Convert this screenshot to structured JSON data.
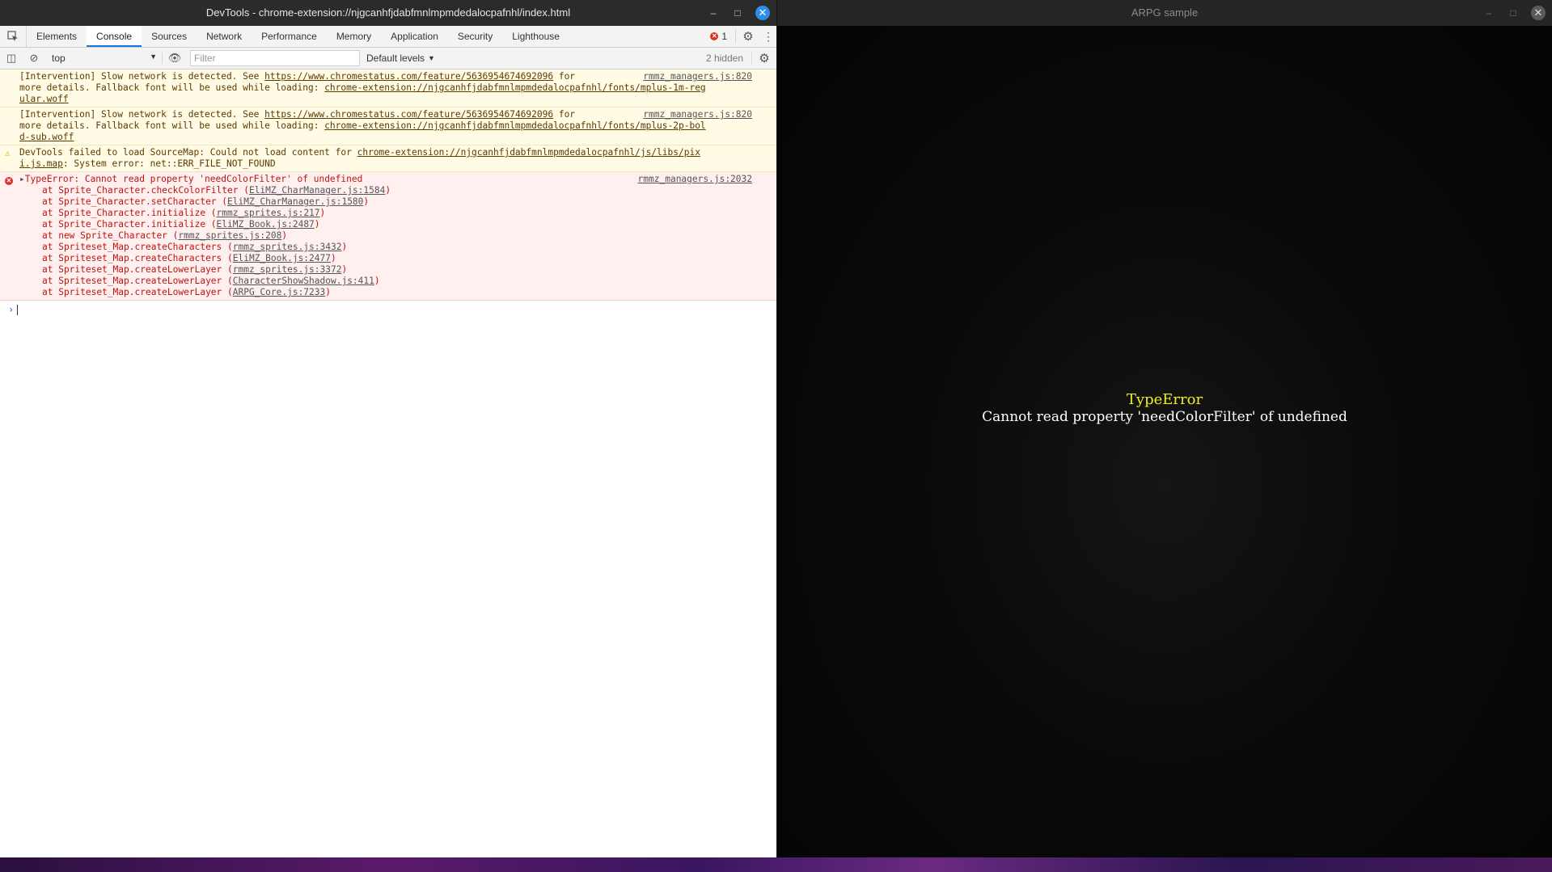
{
  "devtools": {
    "title": "DevTools - chrome-extension://njgcanhfjdabfmnlmpmdedalocpafnhl/index.html",
    "tabs": [
      "Elements",
      "Console",
      "Sources",
      "Network",
      "Performance",
      "Memory",
      "Application",
      "Security",
      "Lighthouse"
    ],
    "active_tab": "Console",
    "error_count": "1",
    "toolbar": {
      "context": "top",
      "filter_placeholder": "Filter",
      "levels": "Default levels",
      "hidden": "2 hidden"
    },
    "messages": [
      {
        "type": "warn",
        "lines": [
          [
            "[Intervention] Slow network is detected. See ",
            "https://www.chromestatus.com/feature/5636954674692096",
            " for"
          ],
          [
            "more details. Fallback font will be used while loading: ",
            "chrome-extension://njgcanhfjdabfmnlmpmdedalocpafnhl/fonts/mplus-1m-reg",
            ""
          ],
          [
            "",
            "ular.woff",
            ""
          ]
        ],
        "source": "rmmz_managers.js:820"
      },
      {
        "type": "warn",
        "lines": [
          [
            "[Intervention] Slow network is detected. See ",
            "https://www.chromestatus.com/feature/5636954674692096",
            " for"
          ],
          [
            "more details. Fallback font will be used while loading: ",
            "chrome-extension://njgcanhfjdabfmnlmpmdedalocpafnhl/fonts/mplus-2p-bol",
            ""
          ],
          [
            "",
            "d-sub.woff",
            ""
          ]
        ],
        "source": "rmmz_managers.js:820"
      },
      {
        "type": "warn-icon",
        "lines": [
          [
            "DevTools failed to load SourceMap: Could not load content for ",
            "chrome-extension://njgcanhfjdabfmnlmpmdedalocpafnhl/js/libs/pix",
            ""
          ],
          [
            "",
            "i.js.map",
            ": System error: net::ERR_FILE_NOT_FOUND"
          ]
        ],
        "source": ""
      }
    ],
    "error": {
      "headline": "TypeError: Cannot read property 'needColorFilter' of undefined",
      "source": "rmmz_managers.js:2032",
      "stack": [
        [
          "at Sprite_Character.checkColorFilter (",
          "EliMZ_CharManager.js:1584",
          ")"
        ],
        [
          "at Sprite_Character.setCharacter (",
          "EliMZ_CharManager.js:1580",
          ")"
        ],
        [
          "at Sprite_Character.initialize (",
          "rmmz_sprites.js:217",
          ")"
        ],
        [
          "at Sprite_Character.initialize (",
          "EliMZ_Book.js:2487",
          ")"
        ],
        [
          "at new Sprite_Character (",
          "rmmz_sprites.js:208",
          ")"
        ],
        [
          "at Spriteset_Map.createCharacters (",
          "rmmz_sprites.js:3432",
          ")"
        ],
        [
          "at Spriteset_Map.createCharacters (",
          "EliMZ_Book.js:2477",
          ")"
        ],
        [
          "at Spriteset_Map.createLowerLayer (",
          "rmmz_sprites.js:3372",
          ")"
        ],
        [
          "at Spriteset_Map.createLowerLayer (",
          "CharacterShowShadow.js:411",
          ")"
        ],
        [
          "at Spriteset_Map.createLowerLayer (",
          "ARPG_Core.js:7233",
          ")"
        ]
      ]
    }
  },
  "game": {
    "title": "ARPG sample",
    "error_title": "TypeError",
    "error_message": "Cannot read property 'needColorFilter' of undefined"
  },
  "colors": {
    "accent": "#1a73e8",
    "error": "#d93025",
    "warning_bg": "#fffbe5",
    "error_bg": "#fff0f0",
    "game_error_title": "#f0f020"
  }
}
